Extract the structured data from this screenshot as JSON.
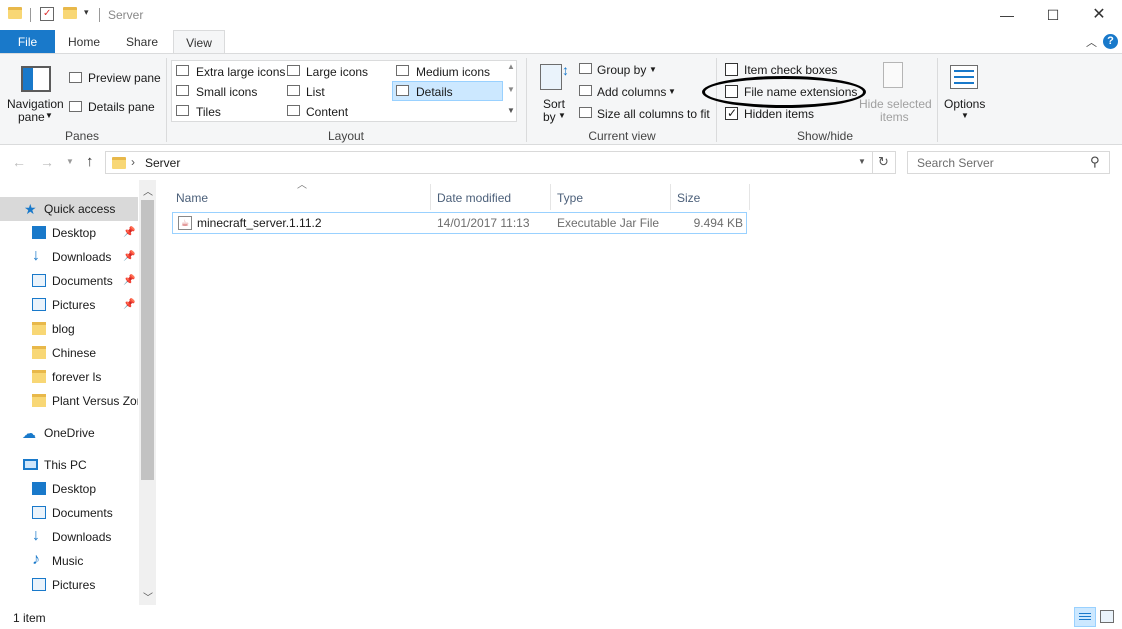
{
  "window": {
    "title": "Server"
  },
  "tabs": {
    "file": "File",
    "home": "Home",
    "share": "Share",
    "view": "View"
  },
  "ribbon": {
    "panes": {
      "label": "Panes",
      "navigation_pane_line1": "Navigation",
      "navigation_pane_line2": "pane",
      "preview_pane": "Preview pane",
      "details_pane": "Details pane"
    },
    "layout": {
      "label": "Layout",
      "extra_large_icons": "Extra large icons",
      "large_icons": "Large icons",
      "medium_icons": "Medium icons",
      "small_icons": "Small icons",
      "list": "List",
      "details": "Details",
      "tiles": "Tiles",
      "content": "Content"
    },
    "current_view": {
      "label": "Current view",
      "sort_line1": "Sort",
      "sort_line2": "by",
      "group_by": "Group by",
      "add_columns": "Add columns",
      "size_all_columns": "Size all columns to fit"
    },
    "show_hide": {
      "label": "Show/hide",
      "item_check_boxes": "Item check boxes",
      "item_check_boxes_checked": false,
      "file_name_extensions": "File name extensions",
      "file_name_extensions_checked": false,
      "hidden_items": "Hidden items",
      "hidden_items_checked": true,
      "hide_selected_line1": "Hide selected",
      "hide_selected_line2": "items"
    },
    "options": {
      "label": "Options"
    }
  },
  "address": {
    "path": "Server",
    "search_placeholder": "Search Server"
  },
  "nav": {
    "quick_access": "Quick access",
    "quick_items": [
      "Desktop",
      "Downloads",
      "Documents",
      "Pictures",
      "blog",
      "Chinese",
      "forever ls",
      "Plant Versus Zon"
    ],
    "onedrive": "OneDrive",
    "this_pc": "This PC",
    "pc_items": [
      "Desktop",
      "Documents",
      "Downloads",
      "Music",
      "Pictures"
    ]
  },
  "columns": {
    "name": "Name",
    "date_modified": "Date modified",
    "type": "Type",
    "size": "Size"
  },
  "files": [
    {
      "name": "minecraft_server.1.11.2",
      "date_modified": "14/01/2017 11:13",
      "type": "Executable Jar File",
      "size": "9.494 KB"
    }
  ],
  "status": {
    "item_count": "1 item"
  },
  "colors": {
    "accent": "#1979ca",
    "selected_bg": "#cce8ff",
    "folder": "#f8d775"
  }
}
